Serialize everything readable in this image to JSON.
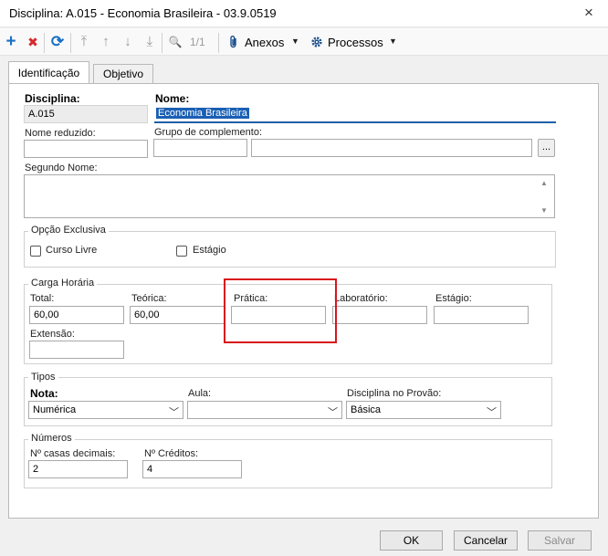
{
  "window": {
    "title": "Disciplina: A.015 - Economia Brasileira - 03.9.0519",
    "close_icon": "×"
  },
  "toolbar": {
    "icons": {
      "add": "+",
      "delete": "✖",
      "refresh": "⟳",
      "first": "⤒",
      "prev": "↑",
      "next": "↓",
      "last": "⤓",
      "search": "🔍"
    },
    "record_count": "1/1",
    "attachments_label": "Anexos",
    "processes_label": "Processos",
    "colors": {
      "add": "#1a6fc4",
      "delete": "#d42b2b",
      "refresh": "#1a6fc4",
      "disabled": "#9a9a9a"
    }
  },
  "tabs": [
    {
      "label": "Identificação",
      "active": true
    },
    {
      "label": "Objetivo",
      "active": false
    }
  ],
  "form": {
    "disciplina_label": "Disciplina:",
    "disciplina_value": "A.015",
    "nome_label": "Nome:",
    "nome_value": "Economia Brasileira",
    "nome_reduzido_label": "Nome reduzido:",
    "nome_reduzido_value": "",
    "grupo_label": "Grupo de complemento:",
    "grupo_code": "",
    "grupo_desc": "",
    "browse_button": "...",
    "segundo_nome_label": "Segundo Nome:",
    "segundo_nome_value": ""
  },
  "opcao_exclusiva": {
    "title": "Opção Exclusiva",
    "curso_livre_label": "Curso Livre",
    "curso_livre_checked": false,
    "estagio_label": "Estágio",
    "estagio_checked": false
  },
  "carga_horaria": {
    "title": "Carga Horária",
    "total_label": "Total:",
    "total_value": "60,00",
    "teorica_label": "Teórica:",
    "teorica_value": "60,00",
    "pratica_label": "Prática:",
    "pratica_value": "",
    "laboratorio_label": "Laboratório:",
    "laboratorio_value": "",
    "estagio_label": "Estágio:",
    "estagio_value": "",
    "extensao_label": "Extensão:",
    "extensao_value": ""
  },
  "tipos": {
    "title": "Tipos",
    "nota_label": "Nota:",
    "nota_value": "Numérica",
    "aula_label": "Aula:",
    "aula_value": "",
    "provao_label": "Disciplina no Provão:",
    "provao_value": "Básica"
  },
  "numeros": {
    "title": "Números",
    "casas_label": "Nº casas decimais:",
    "casas_value": "2",
    "creditos_label": "Nº Créditos:",
    "creditos_value": "4"
  },
  "footer": {
    "ok": "OK",
    "cancel": "Cancelar",
    "save": "Salvar"
  },
  "highlight_color": "#d9161b"
}
